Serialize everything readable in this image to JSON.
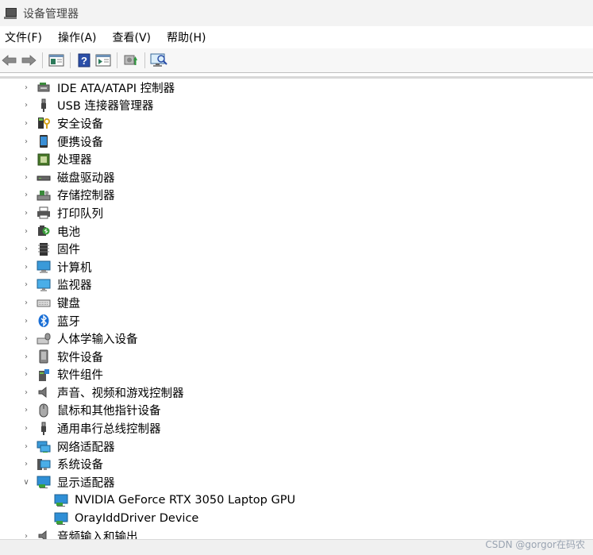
{
  "window": {
    "title": "设备管理器"
  },
  "menu": [
    "文件(F)",
    "操作(A)",
    "查看(V)",
    "帮助(H)"
  ],
  "toolbar": {
    "buttons": [
      "back-icon",
      "forward-icon",
      "show-hide-tree-icon",
      "help-icon",
      "properties-icon",
      "update-driver-icon",
      "scan-hardware-icon"
    ]
  },
  "tree": [
    {
      "label": "IDE ATA/ATAPI 控制器",
      "icon": "ide-controller-icon",
      "expanded": false
    },
    {
      "label": "USB 连接器管理器",
      "icon": "usb-connector-icon",
      "expanded": false
    },
    {
      "label": "安全设备",
      "icon": "security-device-icon",
      "expanded": false
    },
    {
      "label": "便携设备",
      "icon": "portable-device-icon",
      "expanded": false
    },
    {
      "label": "处理器",
      "icon": "processor-icon",
      "expanded": false
    },
    {
      "label": "磁盘驱动器",
      "icon": "disk-drive-icon",
      "expanded": false
    },
    {
      "label": "存储控制器",
      "icon": "storage-controller-icon",
      "expanded": false
    },
    {
      "label": "打印队列",
      "icon": "printer-icon",
      "expanded": false
    },
    {
      "label": "电池",
      "icon": "battery-icon",
      "expanded": false
    },
    {
      "label": "固件",
      "icon": "firmware-icon",
      "expanded": false
    },
    {
      "label": "计算机",
      "icon": "computer-icon",
      "expanded": false
    },
    {
      "label": "监视器",
      "icon": "monitor-icon",
      "expanded": false
    },
    {
      "label": "键盘",
      "icon": "keyboard-icon",
      "expanded": false
    },
    {
      "label": "蓝牙",
      "icon": "bluetooth-icon",
      "expanded": false
    },
    {
      "label": "人体学输入设备",
      "icon": "hid-icon",
      "expanded": false
    },
    {
      "label": "软件设备",
      "icon": "software-device-icon",
      "expanded": false
    },
    {
      "label": "软件组件",
      "icon": "software-component-icon",
      "expanded": false
    },
    {
      "label": "声音、视频和游戏控制器",
      "icon": "audio-icon",
      "expanded": false
    },
    {
      "label": "鼠标和其他指针设备",
      "icon": "mouse-icon",
      "expanded": false
    },
    {
      "label": "通用串行总线控制器",
      "icon": "usb-controller-icon",
      "expanded": false
    },
    {
      "label": "网络适配器",
      "icon": "network-adapter-icon",
      "expanded": false
    },
    {
      "label": "系统设备",
      "icon": "system-device-icon",
      "expanded": false
    },
    {
      "label": "显示适配器",
      "icon": "display-adapter-icon",
      "expanded": true,
      "children": [
        {
          "label": "NVIDIA GeForce RTX 3050 Laptop GPU",
          "icon": "display-adapter-icon"
        },
        {
          "label": "OrayIddDriver Device",
          "icon": "display-adapter-icon"
        }
      ]
    },
    {
      "label": "音频输入和输出",
      "icon": "audio-io-icon",
      "expanded": false
    }
  ],
  "watermark": "CSDN @gorgor在码农"
}
